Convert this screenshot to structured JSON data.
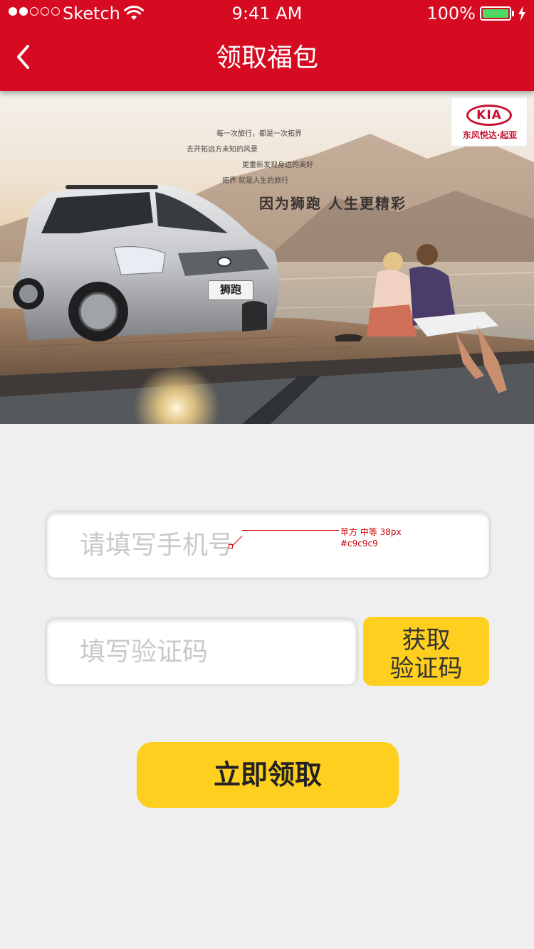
{
  "status_bar": {
    "carrier": "Sketch",
    "time": "9:41 AM",
    "battery_percent": "100%",
    "signal_dots_filled": 2,
    "signal_dots_total": 5
  },
  "nav": {
    "title": "领取福包",
    "back_icon": "chevron-left-icon"
  },
  "banner": {
    "brand_logo_text": "KIA",
    "brand_sub": "东风悦达·起亚",
    "poem_lines": [
      "每一次旅行，都是一次拓界",
      "去开拓远方未知的风景",
      "更重新发现身边的美好",
      "拓界  就是人生的旅行"
    ],
    "slogan": "因为狮跑  人生更精彩",
    "plate_text": "狮跑"
  },
  "form": {
    "phone_placeholder": "请填写手机号",
    "code_placeholder": "填写验证码",
    "get_code_line1": "获取",
    "get_code_line2": "验证码",
    "submit_label": "立即领取"
  },
  "annotation": {
    "font_note": "苹方 中等 38px",
    "color_note": "#c9c9c9"
  },
  "colors": {
    "header_red": "#d60b21",
    "accent_yellow": "#fecf1e",
    "background": "#efefef",
    "placeholder": "#c9c9c9",
    "battery_green": "#4cd964"
  }
}
